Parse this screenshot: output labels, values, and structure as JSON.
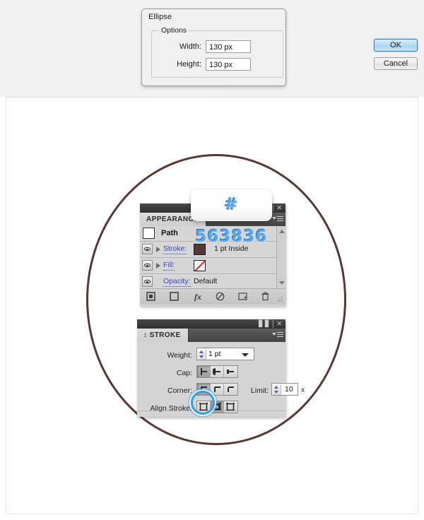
{
  "dialog": {
    "title": "Ellipse",
    "group_legend": "Options",
    "fields": [
      {
        "label": "Width:",
        "value": "130 px",
        "name": "width-field"
      },
      {
        "label": "Height:",
        "value": "130 px",
        "name": "height-field"
      }
    ],
    "buttons": {
      "ok": "OK",
      "cancel": "Cancel"
    }
  },
  "callout": {
    "hex": "# 563836",
    "color": "#563836"
  },
  "appearance_panel": {
    "tab": "APPEARANCE",
    "rows": [
      {
        "name": "path",
        "label": "Path",
        "type": "title"
      },
      {
        "name": "stroke",
        "label": "Stroke:",
        "swatch": "#563836",
        "value": "1 pt  Inside"
      },
      {
        "name": "fill",
        "label": "Fill:",
        "swatch": "none",
        "value": ""
      },
      {
        "name": "opacity",
        "label": "Opacity:",
        "value": "Default"
      }
    ],
    "footer_icons": [
      "add-new-stroke-icon",
      "add-new-fill-icon",
      "add-new-effect-icon",
      "clear-appearance-icon",
      "duplicate-item-icon",
      "delete-item-icon"
    ]
  },
  "stroke_panel": {
    "tab": "STROKE",
    "weight": {
      "label": "Weight:",
      "value": "1 pt"
    },
    "cap": {
      "label": "Cap:",
      "options": [
        "butt-cap",
        "round-cap",
        "projecting-cap"
      ],
      "selected": 0
    },
    "corner": {
      "label": "Corner:",
      "options": [
        "miter-join",
        "round-join",
        "bevel-join"
      ],
      "selected": 0
    },
    "limit": {
      "label": "Limit:",
      "value": "10",
      "unit": "x"
    },
    "align_stroke": {
      "label": "Align Stroke:",
      "options": [
        "align-center",
        "align-inside",
        "align-outside"
      ],
      "selected": 1
    }
  },
  "canvas": {
    "shape_name": "ellipse-path",
    "stroke_color": "#563836"
  }
}
